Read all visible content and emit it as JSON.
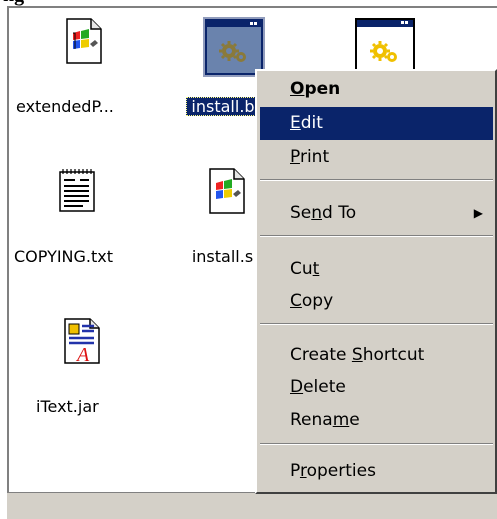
{
  "window": {
    "partial_title": "ng"
  },
  "files": [
    {
      "name": "extendedP...",
      "icon": "windows-batch-icon"
    },
    {
      "name": "install.b",
      "icon": "gear-window-icon",
      "selected": true
    },
    {
      "name": "",
      "icon": "gear-window-yellow-icon"
    },
    {
      "name": "COPYING.txt",
      "icon": "text-document-icon"
    },
    {
      "name": "install.s",
      "icon": "windows-script-icon"
    },
    {
      "name": "iText.jar",
      "icon": "java-archive-icon"
    }
  ],
  "context_menu": {
    "items": [
      {
        "pre": "",
        "key": "O",
        "post": "pen",
        "bold": true
      },
      {
        "pre": "",
        "key": "E",
        "post": "dit",
        "highlighted": true
      },
      {
        "pre": "",
        "key": "P",
        "post": "rint"
      },
      {
        "pre": "Se",
        "key": "n",
        "post": "d To",
        "submenu": true,
        "arrow": "▶"
      },
      {
        "pre": "Cu",
        "key": "t",
        "post": ""
      },
      {
        "pre": "",
        "key": "C",
        "post": "opy"
      },
      {
        "pre": "Create ",
        "key": "S",
        "post": "hortcut"
      },
      {
        "pre": "",
        "key": "D",
        "post": "elete"
      },
      {
        "pre": "Rena",
        "key": "m",
        "post": "e"
      },
      {
        "pre": "P",
        "key": "r",
        "post": "operties"
      }
    ]
  },
  "colors": {
    "selection": "#0a246a",
    "menu_face": "#d4d0c8"
  }
}
